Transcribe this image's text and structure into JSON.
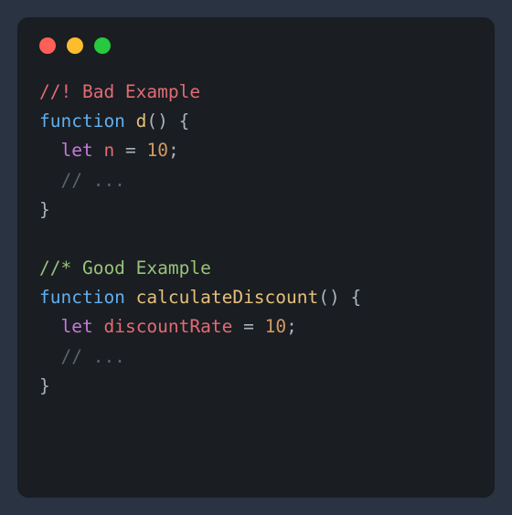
{
  "code": {
    "lines": [
      [
        {
          "cls": "tok-comment-bang",
          "text": "//! Bad Example"
        }
      ],
      [
        {
          "cls": "tok-funcdecl",
          "text": "function"
        },
        {
          "cls": "tok-punct",
          "text": " "
        },
        {
          "cls": "tok-funcname",
          "text": "d"
        },
        {
          "cls": "tok-punct",
          "text": "() {"
        }
      ],
      [
        {
          "cls": "tok-punct",
          "text": "  "
        },
        {
          "cls": "tok-keyword",
          "text": "let"
        },
        {
          "cls": "tok-punct",
          "text": " "
        },
        {
          "cls": "tok-ident",
          "text": "n"
        },
        {
          "cls": "tok-punct",
          "text": " = "
        },
        {
          "cls": "tok-number",
          "text": "10"
        },
        {
          "cls": "tok-punct",
          "text": ";"
        }
      ],
      [
        {
          "cls": "tok-punct",
          "text": "  "
        },
        {
          "cls": "tok-comment",
          "text": "// ..."
        }
      ],
      [
        {
          "cls": "tok-punct",
          "text": "}"
        }
      ],
      [
        {
          "cls": "tok-punct",
          "text": ""
        }
      ],
      [
        {
          "cls": "tok-comment-star",
          "text": "//* Good Example"
        }
      ],
      [
        {
          "cls": "tok-funcdecl",
          "text": "function"
        },
        {
          "cls": "tok-punct",
          "text": " "
        },
        {
          "cls": "tok-funcname",
          "text": "calculateDiscount"
        },
        {
          "cls": "tok-punct",
          "text": "() {"
        }
      ],
      [
        {
          "cls": "tok-punct",
          "text": "  "
        },
        {
          "cls": "tok-keyword",
          "text": "let"
        },
        {
          "cls": "tok-punct",
          "text": " "
        },
        {
          "cls": "tok-ident",
          "text": "discountRate"
        },
        {
          "cls": "tok-punct",
          "text": " = "
        },
        {
          "cls": "tok-number",
          "text": "10"
        },
        {
          "cls": "tok-punct",
          "text": ";"
        }
      ],
      [
        {
          "cls": "tok-punct",
          "text": "  "
        },
        {
          "cls": "tok-comment",
          "text": "// ..."
        }
      ],
      [
        {
          "cls": "tok-punct",
          "text": "}"
        }
      ]
    ]
  }
}
